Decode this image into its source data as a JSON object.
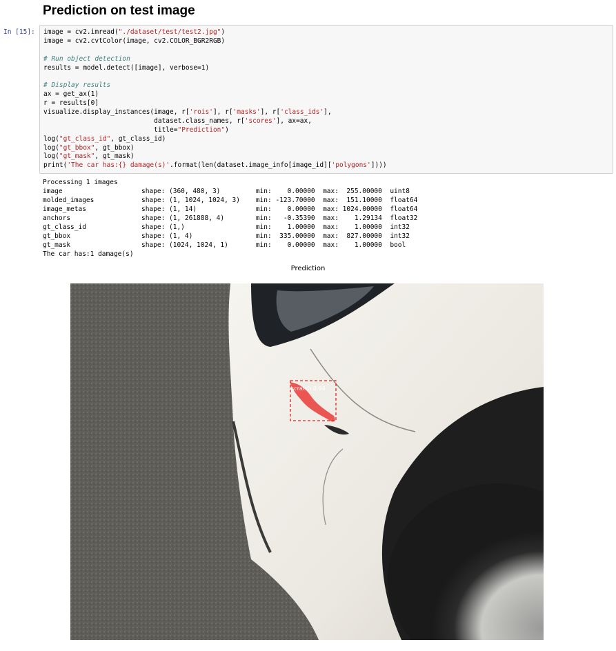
{
  "heading": "Prediction on test image",
  "cell": {
    "prompt": "In [15]:",
    "code": [
      [
        {
          "t": "image = cv2.imread("
        },
        {
          "t": "\"./dataset/test/test2.jpg\"",
          "c": "st"
        },
        {
          "t": ")"
        }
      ],
      [
        {
          "t": "image = cv2.cvtColor(image, cv2.COLOR_BGR2RGB)"
        }
      ],
      [
        {
          "t": ""
        }
      ],
      [
        {
          "t": "# Run object detection",
          "c": "cm"
        }
      ],
      [
        {
          "t": "results = model.detect([image], verbose=1)"
        }
      ],
      [
        {
          "t": ""
        }
      ],
      [
        {
          "t": "# Display results",
          "c": "cm"
        }
      ],
      [
        {
          "t": "ax = get_ax(1)"
        }
      ],
      [
        {
          "t": "r = results[0]"
        }
      ],
      [
        {
          "t": "visualize.display_instances(image, r["
        },
        {
          "t": "'rois'",
          "c": "st"
        },
        {
          "t": "], r["
        },
        {
          "t": "'masks'",
          "c": "st"
        },
        {
          "t": "], r["
        },
        {
          "t": "'class_ids'",
          "c": "st"
        },
        {
          "t": "],"
        }
      ],
      [
        {
          "t": "                            dataset.class_names, r["
        },
        {
          "t": "'scores'",
          "c": "st"
        },
        {
          "t": "], ax=ax,"
        }
      ],
      [
        {
          "t": "                            title="
        },
        {
          "t": "\"Prediction\"",
          "c": "st"
        },
        {
          "t": ")"
        }
      ],
      [
        {
          "t": "log("
        },
        {
          "t": "\"gt_class_id\"",
          "c": "st"
        },
        {
          "t": ", gt_class_id)"
        }
      ],
      [
        {
          "t": "log("
        },
        {
          "t": "\"gt_bbox\"",
          "c": "st"
        },
        {
          "t": ", gt_bbox)"
        }
      ],
      [
        {
          "t": "log("
        },
        {
          "t": "\"gt_mask\"",
          "c": "st"
        },
        {
          "t": ", gt_mask)"
        }
      ],
      [
        {
          "t": "print("
        },
        {
          "t": "'The car has:{} damage(s)'",
          "c": "st"
        },
        {
          "t": ".format(len(dataset.image_info[image_id]["
        },
        {
          "t": "'polygons'",
          "c": "st"
        },
        {
          "t": "])))"
        }
      ]
    ]
  },
  "output": [
    "Processing 1 images",
    "image                    shape: (360, 480, 3)         min:    0.00000  max:  255.00000  uint8",
    "molded_images            shape: (1, 1024, 1024, 3)    min: -123.70000  max:  151.10000  float64",
    "image_metas              shape: (1, 14)               min:    0.00000  max: 1024.00000  float64",
    "anchors                  shape: (1, 261888, 4)        min:   -0.35390  max:    1.29134  float32",
    "gt_class_id              shape: (1,)                  min:    1.00000  max:    1.00000  int32",
    "gt_bbox                  shape: (1, 4)                min:  335.00000  max:  827.00000  int32",
    "gt_mask                  shape: (1024, 1024, 1)       min:    0.00000  max:    1.00000  bool",
    "The car has:1 damage(s)"
  ],
  "figure": {
    "title": "Prediction",
    "detection_label": "scratch 0.94",
    "mask_color": "#e8231f",
    "box_color": "#e8231f"
  }
}
